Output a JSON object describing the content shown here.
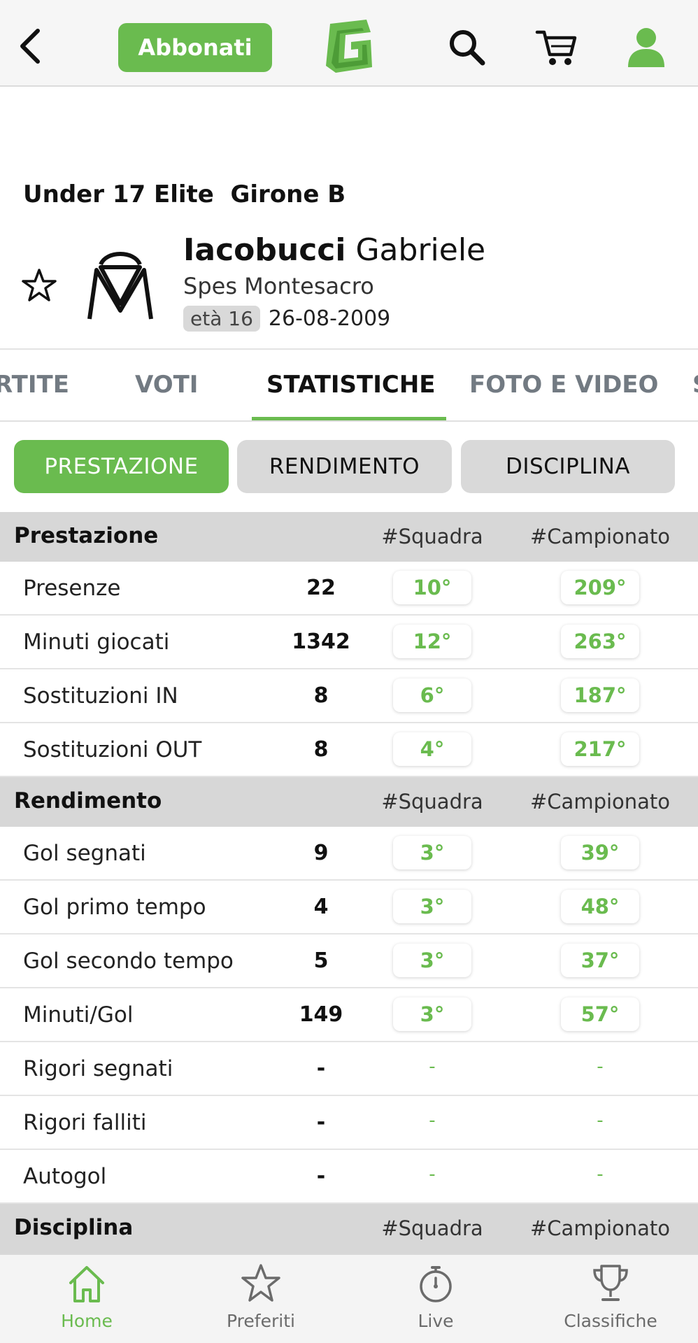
{
  "topbar": {
    "subscribe_label": "Abbonati",
    "brand_letter": "G"
  },
  "header": {
    "league": "Under 17 Elite  Girone B",
    "player_last": "Iacobucci",
    "player_first": "Gabriele",
    "team": "Spes Montesacro",
    "age": "età 16",
    "birthdate": "26-08-2009"
  },
  "tabs": [
    {
      "label": "RTITE"
    },
    {
      "label": "VOTI"
    },
    {
      "label": "STATISTICHE"
    },
    {
      "label": "FOTO E VIDEO"
    },
    {
      "label": "S"
    }
  ],
  "segments": [
    {
      "label": "PRESTAZIONE"
    },
    {
      "label": "RENDIMENTO"
    },
    {
      "label": "DISCIPLINA"
    }
  ],
  "stats": {
    "col_team": "#Squadra",
    "col_league": "#Campionato",
    "sections": [
      {
        "title": "Prestazione",
        "rows": [
          {
            "label": "Presenze",
            "value": "22",
            "team": "10°",
            "league": "209°"
          },
          {
            "label": "Minuti giocati",
            "value": "1342",
            "team": "12°",
            "league": "263°"
          },
          {
            "label": "Sostituzioni IN",
            "value": "8",
            "team": "6°",
            "league": "187°"
          },
          {
            "label": "Sostituzioni OUT",
            "value": "8",
            "team": "4°",
            "league": "217°"
          }
        ]
      },
      {
        "title": "Rendimento",
        "rows": [
          {
            "label": "Gol segnati",
            "value": "9",
            "team": "3°",
            "league": "39°"
          },
          {
            "label": "Gol primo tempo",
            "value": "4",
            "team": "3°",
            "league": "48°"
          },
          {
            "label": "Gol secondo tempo",
            "value": "5",
            "team": "3°",
            "league": "37°"
          },
          {
            "label": "Minuti/Gol",
            "value": "149",
            "team": "3°",
            "league": "57°"
          },
          {
            "label": "Rigori segnati",
            "value": "-",
            "team": "-",
            "league": "-"
          },
          {
            "label": "Rigori falliti",
            "value": "-",
            "team": "-",
            "league": "-"
          },
          {
            "label": "Autogol",
            "value": "-",
            "team": "-",
            "league": "-"
          }
        ]
      },
      {
        "title": "Disciplina",
        "rows": []
      }
    ]
  },
  "bottom_nav": [
    {
      "label": "Home",
      "icon": "home-icon"
    },
    {
      "label": "Preferiti",
      "icon": "star-icon"
    },
    {
      "label": "Live",
      "icon": "stopwatch-icon"
    },
    {
      "label": "Classifiche",
      "icon": "trophy-icon"
    }
  ],
  "colors": {
    "accent": "#6abb4f",
    "section_bg": "#d7d7d7",
    "segment_off": "#d9d9d9"
  }
}
